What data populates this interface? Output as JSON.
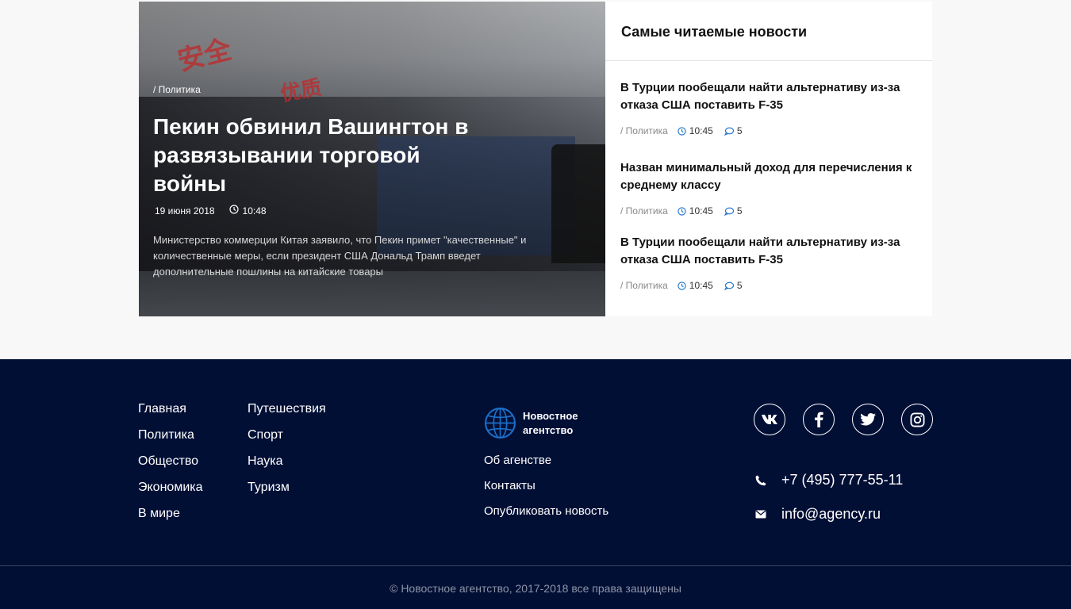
{
  "hero": {
    "category": "/ Политика",
    "title": "Пекин обвинил Вашингтон в развязывании торговой войны",
    "date": "19 июня 2018",
    "time": "10:48",
    "excerpt": "Министерство коммерции Китая заявило, что Пекин примет \"качественные\" и количественные меры, если президент США Дональд Трамп введет дополнительные пошлины на китайские товары",
    "image_sign_texts": [
      "安全",
      "优质"
    ]
  },
  "popular": {
    "heading": "Самые читаемые новости",
    "items": [
      {
        "title": "В Турции пообещали найти альтернативу из-за отказа США поставить F-35",
        "category": "/ Политика",
        "time": "10:45",
        "comments": "5"
      },
      {
        "title": "Назван минимальный доход для перечисления к среднему классу",
        "category": "/ Политика",
        "time": "10:45",
        "comments": "5"
      },
      {
        "title": "В Турции пообещали найти альтернативу из-за отказа США поставить F-35",
        "category": "/ Политика",
        "time": "10:45",
        "comments": "5"
      }
    ]
  },
  "footer": {
    "nav_col1": [
      "Главная",
      "Политика",
      "Общество",
      "Экономика",
      "В мире"
    ],
    "nav_col2": [
      "Путешествия",
      "Спорт",
      "Наука",
      "Туризм"
    ],
    "brand": "Новостное агентство",
    "about_links": [
      "Об агенстве",
      "Контакты",
      "Опубликовать новость"
    ],
    "socials": [
      "vk-icon",
      "facebook-icon",
      "twitter-icon",
      "instagram-icon"
    ],
    "phone": "+7 (495) 777-55-11",
    "email": "info@agency.ru",
    "copyright": "© Новостное агентство, 2017-2018 все права защищены"
  },
  "colors": {
    "footer_bg": "#020f35",
    "accent_blue": "#1c6fc9",
    "page_bg": "#f8f8f8"
  }
}
